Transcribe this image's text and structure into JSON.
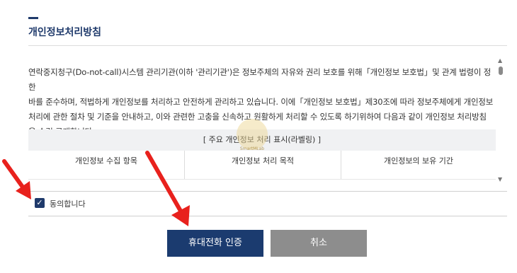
{
  "section": {
    "title": "개인정보처리방침"
  },
  "policy": {
    "intro_lines": [
      "연락중지청구(Do-not-call)시스템 관리기관(이하 '관리기관')은   정보주체의 자유와 권리 보호를 위해「개인정보 보호법」및 관계 법령이 정한",
      "바를 준수하며, 적법하게 개인정보를 처리하고 안전하게 관리하고 있습니다. 이에「개인정보 보호법」제30조에 따라 정보주체에게 개인정보",
      "처리에 관한 절차 및 기준을 안내하고, 이와 관련한 고충을 신속하고 원활하게 처리할 수 있도록 하기위하여 다음과 같이 개인정보 처리방침",
      "을 수립·공개합니다."
    ],
    "table_caption": "[ 주요 개인정보 처리 표시(라벨링) ]",
    "columns": [
      "개인정보 수집 항목",
      "개인정보 처리 목적",
      "개인정보의 보유 기간"
    ]
  },
  "agree": {
    "label": "동의합니다",
    "checked": true
  },
  "buttons": {
    "verify": "휴대전화 인증",
    "cancel": "취소"
  },
  "watermark": {
    "text": "SmartMLab"
  },
  "colors": {
    "primary": "#1b3b6f",
    "cancel": "#8d8d8d",
    "arrow": "#e8211d"
  }
}
